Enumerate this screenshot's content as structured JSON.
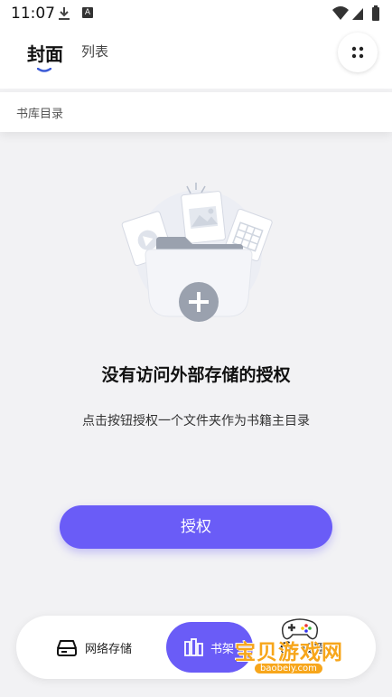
{
  "status_bar": {
    "time": "11:07",
    "a_badge": "A",
    "download_icon": "download-icon",
    "wifi_icon": "wifi-icon",
    "signal_icon": "signal-icon",
    "battery_icon": "battery-icon"
  },
  "header": {
    "tabs": [
      {
        "label": "封面",
        "active": true
      },
      {
        "label": "列表",
        "active": false
      }
    ],
    "menu_icon": "grid-dots-icon"
  },
  "breadcrumb": {
    "label": "书库目录"
  },
  "empty_state": {
    "title": "没有访问外部存储的授权",
    "description": "点击按钮授权一个文件夹作为书籍主目录",
    "illustration": "folder-with-files-illustration"
  },
  "auth_button": {
    "label": "授权"
  },
  "bottom_nav": {
    "items": [
      {
        "label": "网络存储",
        "icon": "network-drive-icon",
        "active": false
      },
      {
        "label": "书架",
        "icon": "bookshelf-icon",
        "active": true
      },
      {
        "label": "设置",
        "icon": "settings-icon",
        "active": false
      }
    ]
  },
  "watermark": {
    "text": "宝贝游戏网",
    "url": "baobeiy.com"
  },
  "colors": {
    "accent": "#6a5cf7",
    "background": "#f2f2f4",
    "watermark": "#f7a61b"
  }
}
